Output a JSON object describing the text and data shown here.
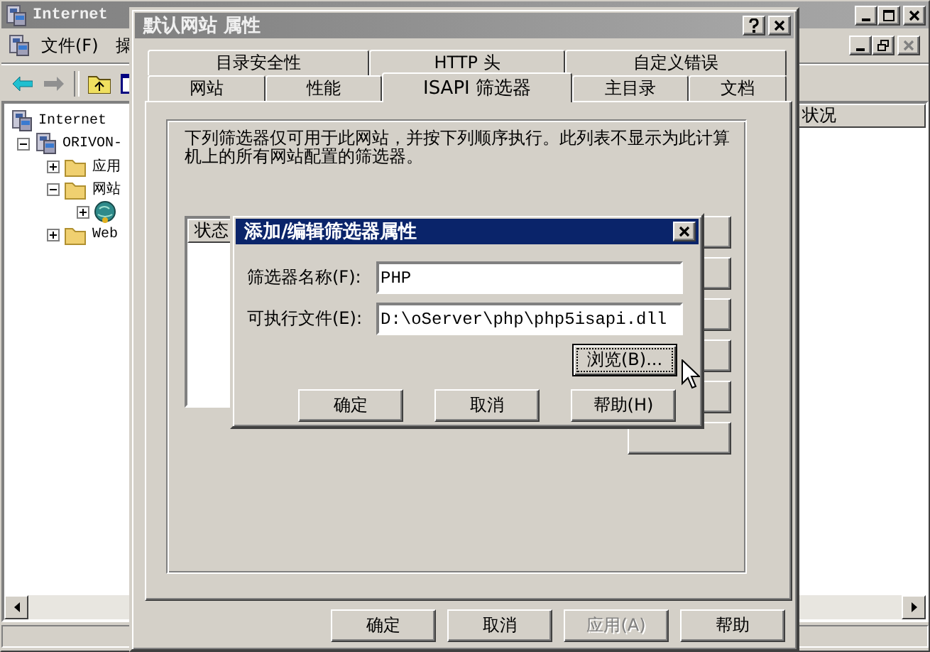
{
  "main_window": {
    "title": "Internet",
    "menu": [
      "文件(F)",
      "操"
    ],
    "tree": [
      {
        "label": "Internet",
        "kind": "computer",
        "children": [
          {
            "label": "ORIVON-",
            "kind": "computer",
            "expanded": true,
            "children": [
              {
                "label": "应用",
                "kind": "folder",
                "expanded": false
              },
              {
                "label": "网站",
                "kind": "folder",
                "expanded": true,
                "children": [
                  {
                    "kind": "site",
                    "expanded": false
                  }
                ]
              },
              {
                "label": "Web",
                "kind": "folder",
                "expanded": false
              }
            ]
          }
        ]
      }
    ],
    "columns": [
      "状况"
    ]
  },
  "properties_dialog": {
    "title": "默认网站 属性",
    "tab_rows": [
      [
        {
          "label": "目录安全性",
          "selected": false
        },
        {
          "label": "HTTP 头",
          "selected": false
        },
        {
          "label": "自定义错误",
          "selected": false
        }
      ],
      [
        {
          "label": "网站",
          "selected": false
        },
        {
          "label": "性能",
          "selected": false
        },
        {
          "label": "ISAPI 筛选器",
          "selected": true
        },
        {
          "label": "主目录",
          "selected": false
        },
        {
          "label": "文档",
          "selected": false
        }
      ]
    ],
    "description": "下列筛选器仅可用于此网站，并按下列顺序执行。此列表不显示为此计算机上的所有网站配置的筛选器。",
    "filter_list": {
      "columns": [
        "状态"
      ]
    },
    "buttons": [
      {
        "label": "确定",
        "disabled": false
      },
      {
        "label": "取消",
        "disabled": false
      },
      {
        "label": "应用(A)",
        "disabled": true
      },
      {
        "label": "帮助",
        "disabled": false
      }
    ]
  },
  "filter_dialog": {
    "title": "添加/编辑筛选器属性",
    "fields": [
      {
        "label": "筛选器名称(F):",
        "value": "PHP"
      },
      {
        "label": "可执行文件(E):",
        "value": "D:\\oServer\\php\\php5isapi.dll"
      }
    ],
    "browse_button": "浏览(B)...",
    "buttons": [
      {
        "label": "确定"
      },
      {
        "label": "取消"
      },
      {
        "label": "帮助(H)"
      }
    ]
  }
}
